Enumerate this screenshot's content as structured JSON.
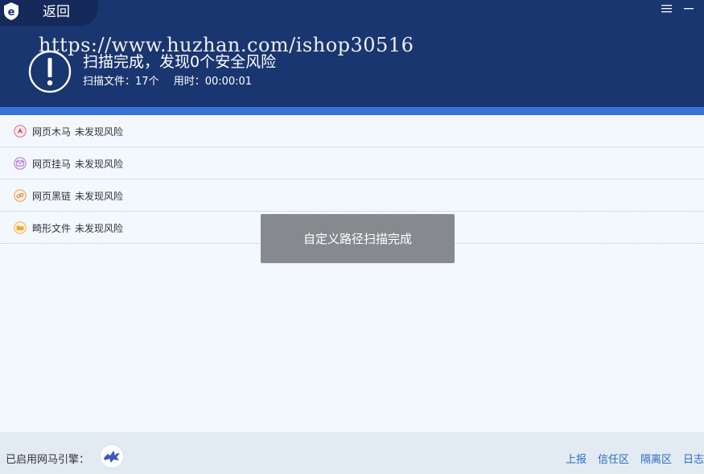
{
  "header": {
    "back_label": "返回",
    "watermark": "https://www.huzhan.com/ishop30516",
    "title": "扫描完成，发现0个安全风险",
    "files_scanned": "扫描文件：17个",
    "elapsed": "用时：00:00:01"
  },
  "results": [
    {
      "name": "网页木马",
      "status": "未发现风险",
      "icon": "trojan-icon"
    },
    {
      "name": "网页挂马",
      "status": "未发现风险",
      "icon": "mail-horse-icon"
    },
    {
      "name": "网页黑链",
      "status": "未发现风险",
      "icon": "link-icon"
    },
    {
      "name": "畸形文件",
      "status": "未发现风险",
      "icon": "folder-icon"
    }
  ],
  "toast": {
    "message": "自定义路径扫描完成"
  },
  "footer": {
    "engine_label": "已启用网马引擎：",
    "links": [
      "上报",
      "信任区",
      "隔离区",
      "日志"
    ]
  },
  "colors": {
    "header_bg": "#1a3670",
    "accent_bar": "#3a73d7",
    "link": "#2a6bc2",
    "toast_bg": "#868a8e"
  }
}
